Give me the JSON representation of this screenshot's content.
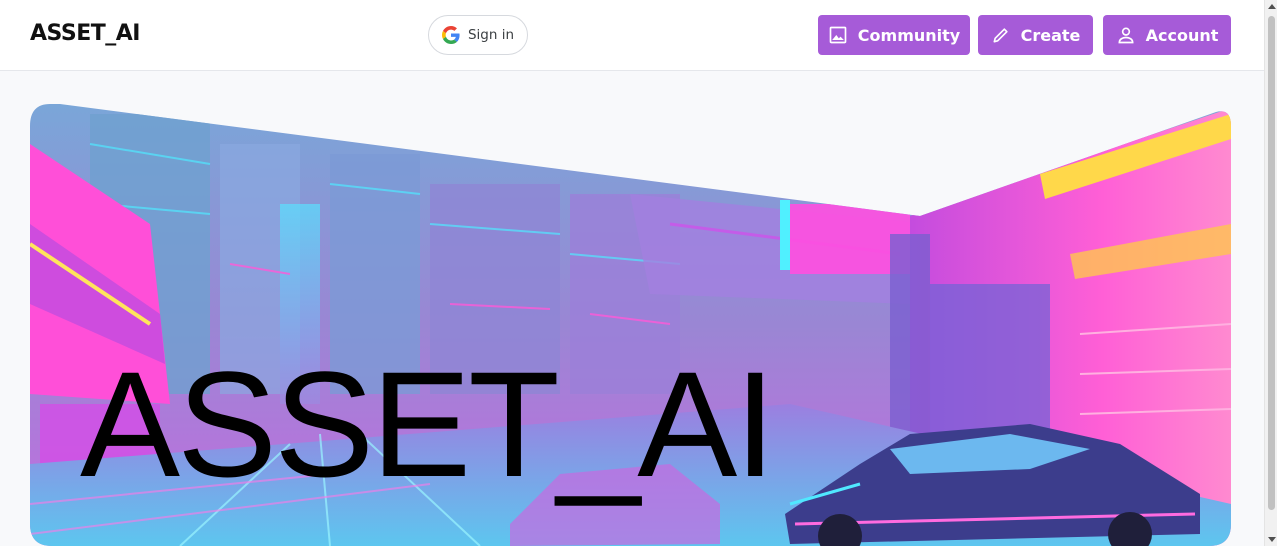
{
  "brand": {
    "name": "ASSET_AI"
  },
  "header": {
    "signin_label": "Sign in",
    "nav": [
      {
        "label": "Community",
        "icon": "image-icon"
      },
      {
        "label": "Create",
        "icon": "pencil-icon"
      },
      {
        "label": "Account",
        "icon": "user-icon"
      }
    ]
  },
  "hero": {
    "title": "ASSET_AI",
    "image_alt": "cyberpunk neon city street with car"
  },
  "colors": {
    "accent": "#a65bd8",
    "header_bg": "#ffffff",
    "page_bg": "#f8f9fb"
  }
}
